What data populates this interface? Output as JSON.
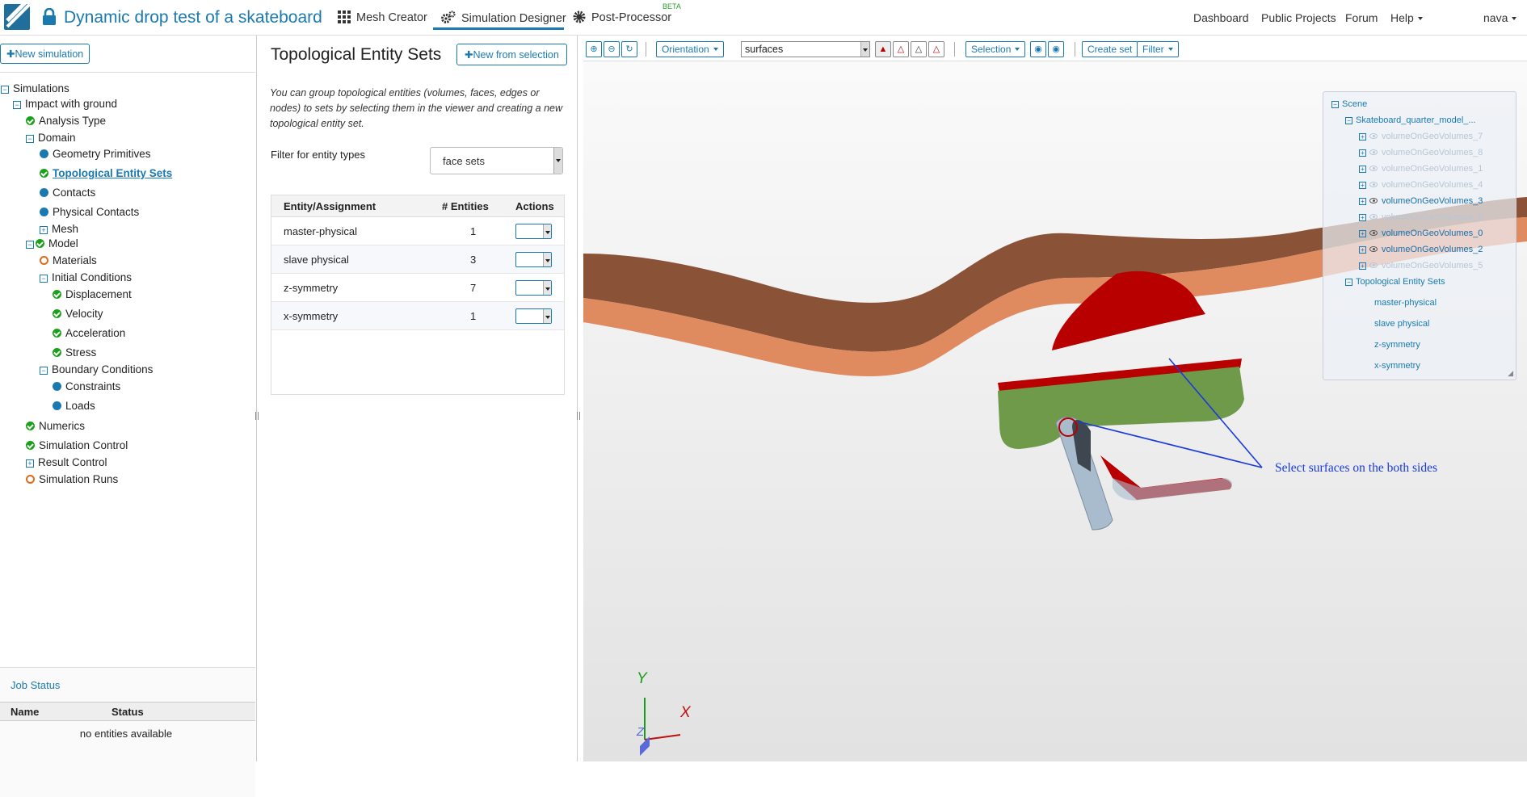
{
  "app": {
    "title": "Dynamic drop test of a skateboard",
    "nav": [
      "Mesh Creator",
      "Simulation Designer",
      "Post-Processor"
    ],
    "beta_badge": "BETA",
    "right_nav": [
      "Dashboard",
      "Public Projects",
      "Forum",
      "Help",
      "nava"
    ]
  },
  "sidebar": {
    "new_button": "New simulation",
    "tree": [
      {
        "label": "Simulations",
        "status": "toggle"
      },
      {
        "label": "Impact with ground",
        "status": "toggle"
      },
      {
        "label": "Analysis Type",
        "status": "ok"
      },
      {
        "label": "Domain",
        "status": "toggle"
      },
      {
        "label": "Geometry Primitives",
        "status": "info"
      },
      {
        "label": "Topological Entity Sets",
        "status": "ok"
      },
      {
        "label": "Contacts",
        "status": "info"
      },
      {
        "label": "Physical Contacts",
        "status": "info"
      },
      {
        "label": "Mesh",
        "status": "expand"
      },
      {
        "label": "Model",
        "status": "ok"
      },
      {
        "label": "Materials",
        "status": "empty"
      },
      {
        "label": "Initial Conditions",
        "status": "toggle"
      },
      {
        "label": "Displacement",
        "status": "ok"
      },
      {
        "label": "Velocity",
        "status": "ok"
      },
      {
        "label": "Acceleration",
        "status": "ok"
      },
      {
        "label": "Stress",
        "status": "ok"
      },
      {
        "label": "Boundary Conditions",
        "status": "toggle"
      },
      {
        "label": "Constraints",
        "status": "info"
      },
      {
        "label": "Loads",
        "status": "info"
      },
      {
        "label": "Numerics",
        "status": "ok"
      },
      {
        "label": "Simulation Control",
        "status": "ok"
      },
      {
        "label": "Result Control",
        "status": "expand"
      },
      {
        "label": "Simulation Runs",
        "status": "empty"
      }
    ],
    "job_status": {
      "title": "Job Status",
      "columns": [
        "Name",
        "Status"
      ],
      "empty_text": "no entities available"
    }
  },
  "main": {
    "title": "Topological Entity Sets",
    "new_from_selection": "New from selection",
    "description": "You can group topological entities (volumes, faces, edges or nodes) to sets by selecting them in the viewer and creating a new topological entity set.",
    "filter_label": "Filter for entity types",
    "filter_value": "face sets",
    "table": {
      "columns": [
        "Entity/Assignment",
        "# Entities",
        "Actions"
      ],
      "rows": [
        {
          "name": "master-physical",
          "count": "1"
        },
        {
          "name": "slave physical",
          "count": "3"
        },
        {
          "name": "z-symmetry",
          "count": "7"
        },
        {
          "name": "x-symmetry",
          "count": "1"
        }
      ]
    }
  },
  "viewer": {
    "toolbar": {
      "orientation": "Orientation",
      "surfaces": "surfaces",
      "selection": "Selection",
      "create_set": "Create set",
      "filter": "Filter"
    },
    "scene_tree": {
      "root": "Scene",
      "model": "Skateboard_quarter_model_...",
      "volumes": [
        {
          "label": "volumeOnGeoVolumes_7",
          "visible": false
        },
        {
          "label": "volumeOnGeoVolumes_8",
          "visible": false
        },
        {
          "label": "volumeOnGeoVolumes_1",
          "visible": false
        },
        {
          "label": "volumeOnGeoVolumes_4",
          "visible": false
        },
        {
          "label": "volumeOnGeoVolumes_3",
          "visible": true
        },
        {
          "label": "volumeOnGeoVolumes_6",
          "visible": false
        },
        {
          "label": "volumeOnGeoVolumes_0",
          "visible": true
        },
        {
          "label": "volumeOnGeoVolumes_2",
          "visible": true
        },
        {
          "label": "volumeOnGeoVolumes_5",
          "visible": false
        }
      ],
      "sets_label": "Topological Entity Sets",
      "sets": [
        "master-physical",
        "slave physical",
        "z-symmetry",
        "x-symmetry"
      ]
    },
    "annotation": "Select surfaces on the both sides",
    "axes": {
      "y": "Y",
      "x": "X",
      "z": "Z"
    },
    "colors": {
      "board_top": "#8a5236",
      "board_edge": "#e08a60",
      "selection_red": "#b80000",
      "baseplate": "#6e9a4a",
      "truck": "#a9bccd",
      "accent": "#1a7ab0"
    }
  }
}
